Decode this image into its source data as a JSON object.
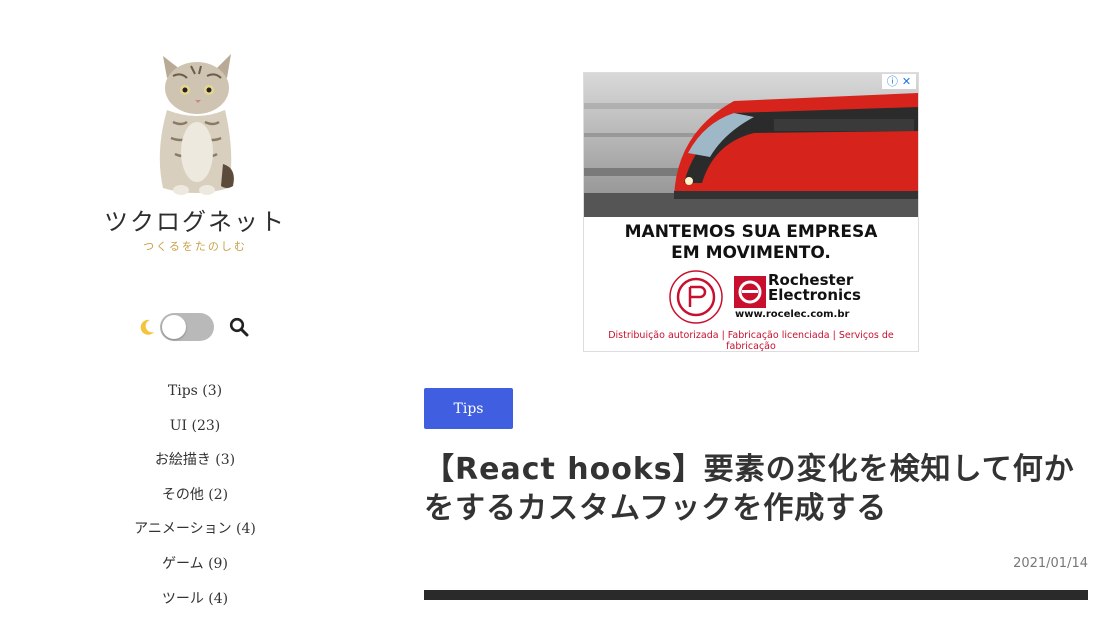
{
  "site": {
    "title": "ツクログネット",
    "subtitle": "つくるをたのしむ"
  },
  "controls": {
    "moon_icon": "moon-icon",
    "search_icon": "search-icon",
    "dark_mode_on": false
  },
  "categories": [
    {
      "label": "Tips (3)"
    },
    {
      "label": "UI (23)"
    },
    {
      "label": "お絵描き (3)"
    },
    {
      "label": "その他 (2)"
    },
    {
      "label": "アニメーション (4)"
    },
    {
      "label": "ゲーム (9)"
    },
    {
      "label": "ツール (4)"
    }
  ],
  "ad": {
    "headline_1": "MANTEMOS SUA EMPRESA",
    "headline_2": "EM MOVIMENTO.",
    "brand_1": "Rochester",
    "brand_2": "Electronics",
    "url": "www.rocelec.com.br",
    "footer": "Distribuição autorizada | Fabricação licenciada | Serviços de fabricação",
    "adchoices_i": "ⓘ",
    "adchoices_x": "✕",
    "accent_color": "#c8102e"
  },
  "post": {
    "tag": "Tips",
    "title": "【React hooks】要素の変化を検知して何かをするカスタムフックを作成する",
    "date": "2021/01/14"
  },
  "colors": {
    "tag_bg": "#3f5fe0",
    "moon": "#f2c53d"
  }
}
